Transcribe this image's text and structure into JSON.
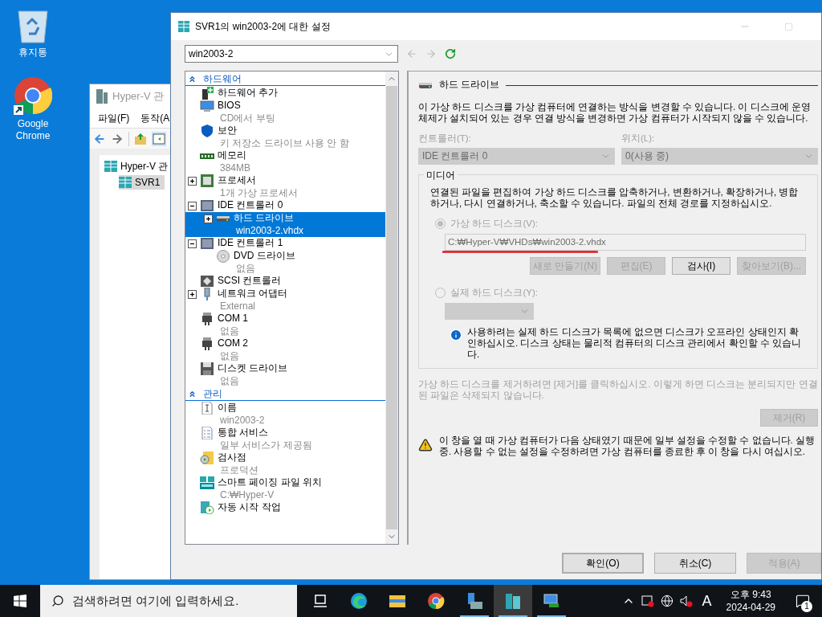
{
  "desktop_icons": [
    {
      "kind": "recycle",
      "label": "휴지통"
    },
    {
      "kind": "browser",
      "label": "Google Chrome"
    }
  ],
  "manager_window": {
    "title": "Hyper-V 관",
    "menu": [
      "파일(F)",
      "동작(A"
    ],
    "tree": [
      {
        "label": "Hyper-V 관",
        "selected": false,
        "children": [
          {
            "label": "SVR1",
            "selected": true
          }
        ]
      }
    ]
  },
  "settings_window": {
    "title": "SVR1의 win2003-2에 대한 설정",
    "vm_select": "win2003-2",
    "sections": [
      {
        "title": "하드웨어",
        "items": [
          {
            "kind": "add-hardware",
            "label": "하드웨어 추가",
            "selected": false
          },
          {
            "kind": "bios",
            "label": "BIOS",
            "detail": "CD에서 부팅",
            "selected": false
          },
          {
            "kind": "security",
            "label": "보안",
            "detail": "키 저장소 드라이브 사용 안 함",
            "selected": false
          },
          {
            "kind": "memory",
            "label": "메모리",
            "detail": "384MB",
            "selected": false
          },
          {
            "kind": "processor",
            "label": "프로세서",
            "detail": "1개 가상 프로세서",
            "expanded": false,
            "selected": false
          },
          {
            "kind": "controller",
            "label": "IDE 컨트롤러 0",
            "expanded": true,
            "selected": false,
            "children": [
              {
                "kind": "hard-drive",
                "label": "하드 드라이브",
                "detail": "win2003-2.vhdx",
                "expanded": false,
                "selected": true
              }
            ]
          },
          {
            "kind": "controller",
            "label": "IDE 컨트롤러 1",
            "expanded": true,
            "selected": false,
            "children": [
              {
                "kind": "dvd",
                "label": "DVD 드라이브",
                "detail": "없음",
                "selected": false
              }
            ]
          },
          {
            "kind": "scsi",
            "label": "SCSI 컨트롤러",
            "selected": false
          },
          {
            "kind": "network",
            "label": "네트워크 어댑터",
            "detail": "External",
            "expanded": false,
            "selected": false
          },
          {
            "kind": "com",
            "label": "COM 1",
            "detail": "없음",
            "selected": false
          },
          {
            "kind": "com",
            "label": "COM 2",
            "detail": "없음",
            "selected": false
          },
          {
            "kind": "floppy",
            "label": "디스켓 드라이브",
            "detail": "없음",
            "selected": false
          }
        ]
      },
      {
        "title": "관리",
        "items": [
          {
            "kind": "name",
            "label": "이름",
            "detail": "win2003-2",
            "selected": false
          },
          {
            "kind": "services",
            "label": "통합 서비스",
            "detail": "일부 서비스가 제공됨",
            "selected": false
          },
          {
            "kind": "checkpoint",
            "label": "검사점",
            "detail": "프로덕션",
            "selected": false
          },
          {
            "kind": "paging",
            "label": "스마트 페이징 파일 위치",
            "detail": "C:₩Hyper-V",
            "selected": false
          },
          {
            "kind": "autostart",
            "label": "자동 시작 작업",
            "selected": false
          }
        ]
      }
    ],
    "hard_drive": {
      "title": "하드 드라이브",
      "description": "이 가상 하드 디스크를 가상 컴퓨터에 연결하는 방식을 변경할 수 있습니다. 이 디스크에 운영 체제가 설치되어 있는 경우 연결 방식을 변경하면 가상 컴퓨터가 시작되지 않을 수 있습니다.",
      "controller": {
        "label": "컨트롤러(T):",
        "value": "IDE 컨트롤러 0",
        "disabled": true
      },
      "location": {
        "label": "위치(L):",
        "value": "0(사용 중)",
        "disabled": true
      },
      "media": {
        "title": "미디어",
        "description": "연결된 파일을 편집하여 가상 하드 디스크를 압축하거나, 변환하거나, 확장하거나, 병합하거나, 다시 연결하거나, 축소할 수 있습니다. 파일의 전체 경로를 지정하십시오.",
        "options": [
          {
            "label": "가상 하드 디스크(V):",
            "selected": true,
            "disabled": true
          },
          {
            "label": "실제 하드 디스크(Y):",
            "selected": false,
            "disabled": true
          }
        ],
        "path": {
          "value": "C:₩Hyper-V₩VHDs₩win2003-2.vhdx",
          "disabled": true,
          "underlined": true
        },
        "disk_buttons": [
          {
            "label": "새로 만들기(N)",
            "disabled": true
          },
          {
            "label": "편집(E)",
            "disabled": true
          },
          {
            "label": "검사(I)",
            "disabled": false
          },
          {
            "label": "찾아보기(B)...",
            "disabled": true
          }
        ],
        "physical_select": {
          "disabled": true
        },
        "info": "사용하려는 실제 하드 디스크가 목록에 없으면 디스크가 오프라인 상태인지 확인하십시오. 디스크 상태는 물리적 컴퓨터의 디스크 관리에서 확인할 수 있습니다."
      },
      "remove_note": "가상 하드 디스크를 제거하려면 [제거]를 클릭하십시오. 이렇게 하면 디스크는 분리되지만 연결된 파일은 삭제되지 않습니다.",
      "remove_button": {
        "label": "제거(R)",
        "disabled": true
      },
      "warning": "이 창을 열 때 가상 컴퓨터가 다음 상태였기 때문에 일부 설정을 수정할 수 없습니다. 실행 중. 사용할 수 없는 설정을 수정하려면 가상 컴퓨터를 종료한 후 이 창을 다시 여십시오."
    },
    "buttons": [
      {
        "label": "확인(O)",
        "default": true,
        "disabled": false
      },
      {
        "label": "취소(C)",
        "default": false,
        "disabled": false
      },
      {
        "label": "적용(A)",
        "default": false,
        "disabled": true
      }
    ]
  },
  "taskbar": {
    "search_placeholder": "검색하려면 여기에 입력하세요.",
    "apps": [
      {
        "kind": "task-view",
        "running": false,
        "active": false
      },
      {
        "kind": "edge",
        "running": false,
        "active": false
      },
      {
        "kind": "explorer",
        "running": false,
        "active": false
      },
      {
        "kind": "chrome",
        "running": false,
        "active": false
      },
      {
        "kind": "server-manager",
        "running": true,
        "active": false
      },
      {
        "kind": "hyperv",
        "running": true,
        "active": true
      },
      {
        "kind": "vmconnect",
        "running": true,
        "active": false
      }
    ],
    "tray": {
      "ime": "A",
      "time": "오후 9:43",
      "date": "2024-04-29",
      "notifications": "1"
    }
  }
}
